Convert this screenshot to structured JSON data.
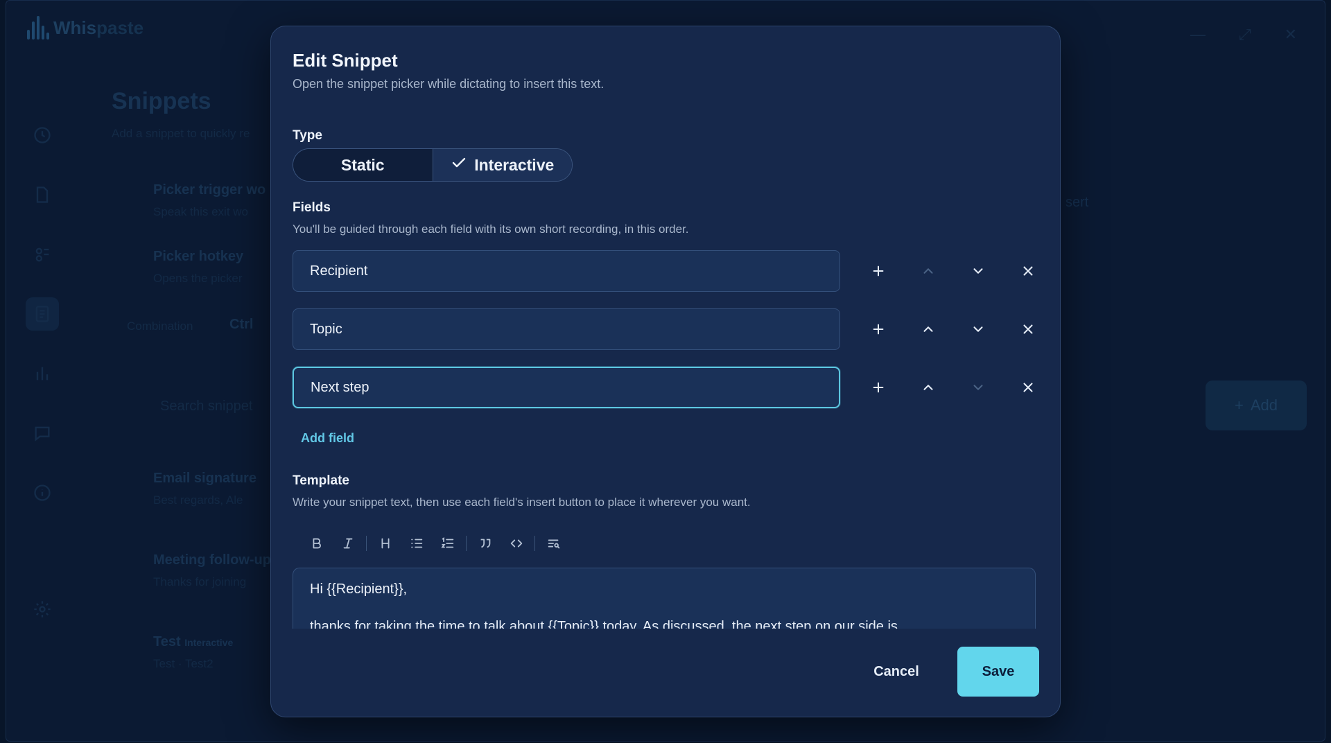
{
  "background": {
    "app_name_part1": "Whis",
    "app_name_part2": "paste",
    "page_title": "Snippets",
    "page_subtitle": "Add a snippet to quickly re",
    "cards": [
      {
        "title": "Picker trigger wo",
        "subtitle": "Speak this exit wo"
      },
      {
        "title": "Picker hotkey",
        "subtitle": "Opens the picker"
      }
    ],
    "combination_label": "Combination",
    "combination_value": "Ctrl",
    "insert_label": "sert",
    "search_placeholder": "Search snippet",
    "add_label": "Add",
    "snippets": [
      {
        "title": "Email signature",
        "subtitle": "Best regards, Ale"
      },
      {
        "title": "Meeting follow-up",
        "subtitle": "Thanks for joining"
      },
      {
        "title": "Test",
        "badge": "Interactive",
        "subtitle": "Test · Test2"
      }
    ]
  },
  "modal": {
    "title": "Edit Snippet",
    "subtitle": "Open the snippet picker while dictating to insert this text.",
    "type_label": "Type",
    "type_options": {
      "static": "Static",
      "interactive": "Interactive"
    },
    "type_selected": "interactive",
    "fields_label": "Fields",
    "fields_help": "You'll be guided through each field with its own short recording, in this order.",
    "fields": [
      {
        "value": "Recipient",
        "up_enabled": false,
        "down_enabled": true
      },
      {
        "value": "Topic",
        "up_enabled": true,
        "down_enabled": true
      },
      {
        "value": "Next step",
        "up_enabled": true,
        "down_enabled": false,
        "focused": true
      }
    ],
    "add_field_label": "Add field",
    "template_label": "Template",
    "template_help": "Write your snippet text, then use each field's insert button to place it wherever you want.",
    "toolbar_icons": [
      "bold-icon",
      "italic-icon",
      "heading-icon",
      "bullet-list-icon",
      "ordered-list-icon",
      "quote-icon",
      "code-icon",
      "insert-field-icon"
    ],
    "template_line1": "Hi {{Recipient}},",
    "template_line2": "thanks for taking the time to talk about {{Topic}} today. As discussed, the next step on our side is",
    "cancel_label": "Cancel",
    "save_label": "Save"
  },
  "colors": {
    "accent": "#62d6ec",
    "modal_bg": "#16284b",
    "input_bg": "#1a3158",
    "focus_border": "#5cc6e0"
  }
}
